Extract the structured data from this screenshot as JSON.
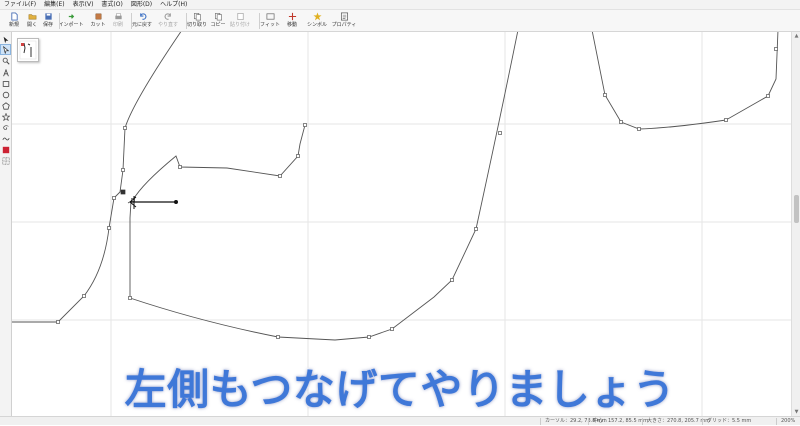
{
  "menu": [
    "ファイル(F)",
    "編集(E)",
    "表示(V)",
    "書式(O)",
    "図形(D)",
    "ヘルプ(H)"
  ],
  "toolbar": [
    {
      "label": "新規",
      "icon": "new-file-icon",
      "color": "#4a6fb5",
      "enabled": true
    },
    {
      "label": "開く",
      "icon": "open-folder-icon",
      "color": "#e0b040",
      "enabled": true
    },
    {
      "label": "保存",
      "icon": "save-icon",
      "color": "#4a6fb5",
      "enabled": true
    },
    {
      "label": "インポート",
      "icon": "import-icon",
      "color": "#3a9a3a",
      "enabled": true
    },
    {
      "label": "カット",
      "icon": "cut-icon",
      "color": "#c47a45",
      "enabled": true
    },
    {
      "label": "印刷",
      "icon": "print-icon",
      "color": "#9a9a9a",
      "enabled": false
    },
    {
      "label": "元に戻す",
      "icon": "undo-icon",
      "color": "#3a6fc4",
      "enabled": true
    },
    {
      "label": "やり直す",
      "icon": "redo-icon",
      "color": "#9a9a9a",
      "enabled": false
    },
    {
      "label": "切り取り",
      "icon": "scissors-icon",
      "color": "#6a6a6a",
      "enabled": true
    },
    {
      "label": "コピー",
      "icon": "copy-icon",
      "color": "#6a6a6a",
      "enabled": true
    },
    {
      "label": "貼り付け",
      "icon": "paste-icon",
      "color": "#9a9a9a",
      "enabled": false
    },
    {
      "label": "フィット",
      "icon": "fit-icon",
      "color": "#6a6a6a",
      "enabled": true
    },
    {
      "label": "移動",
      "icon": "move-icon",
      "color": "#c0392b",
      "enabled": true
    },
    {
      "label": "シンボル",
      "icon": "star-icon",
      "color": "#e0b020",
      "enabled": true
    },
    {
      "label": "プロパティ",
      "icon": "properties-icon",
      "color": "#555555",
      "enabled": true
    }
  ],
  "tools": [
    "arrow-select-icon",
    "node-edit-icon",
    "zoom-icon",
    "text-tool-icon",
    "rectangle-tool-icon",
    "ellipse-tool-icon",
    "polygon-tool-icon",
    "star-tool-icon",
    "spiral-tool-icon",
    "freehand-tool-icon",
    "color-fill-icon",
    "grid-icon"
  ],
  "status": {
    "cursor": "カーソル：29.2, 73.8 mm",
    "center": "中心：157.2, 85.5 mm",
    "size": "大きさ：270.8, 205.7 mm",
    "grid": "グリッド：5.5 mm",
    "zoom": "200%"
  },
  "caption": "左側もつなげてやりましょう",
  "colors": {
    "caption_fill": "#3f78d8",
    "caption_stroke": "#ffffff",
    "path": "#555555",
    "grid": "#e6e6e6",
    "active_color": "#cc2233"
  }
}
